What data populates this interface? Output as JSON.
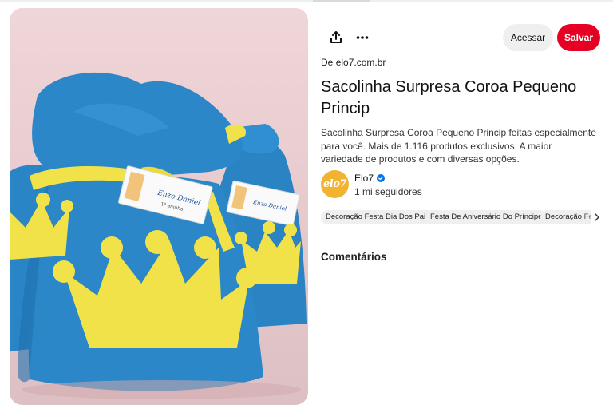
{
  "pin": {
    "source_prefix": "De",
    "source_domain": "elo7.com.br",
    "title": "Sacolinha Surpresa Coroa Pequeno Princip",
    "description": "Sacolinha Surpresa Coroa Pequeno Princip feitas especialmente para você. Mais de 1.116 produtos exclusivos. A maior variedade de produtos e com diversas opções.",
    "image_alt": "Sacolinha Surpresa Coroa Pequeno Princip",
    "image_tag_text": "Enzo Daniel",
    "image_tag_subtext": "1º aninho"
  },
  "toolbar": {
    "share_icon": "share-icon",
    "more_icon": "more-icon",
    "visit_label": "Acessar",
    "save_label": "Salvar"
  },
  "creator": {
    "avatar_text": "elo7",
    "name": "Elo7",
    "followers": "1 mi seguidores",
    "verified_icon": "verified-badge-icon"
  },
  "tags": [
    {
      "label": "Decoração Festa Dia Dos Pais"
    },
    {
      "label": "Festa De Aniversário Do Príncipe"
    },
    {
      "label": "Decoração Fes"
    }
  ],
  "comments": {
    "heading": "Comentários"
  },
  "colors": {
    "save_red": "#e60023",
    "visit_gray": "#efefef",
    "bag_blue": "#2b87c8",
    "crown_yellow": "#f2e24a",
    "avatar_gold": "#f2b430",
    "verified_blue": "#0074e8"
  }
}
